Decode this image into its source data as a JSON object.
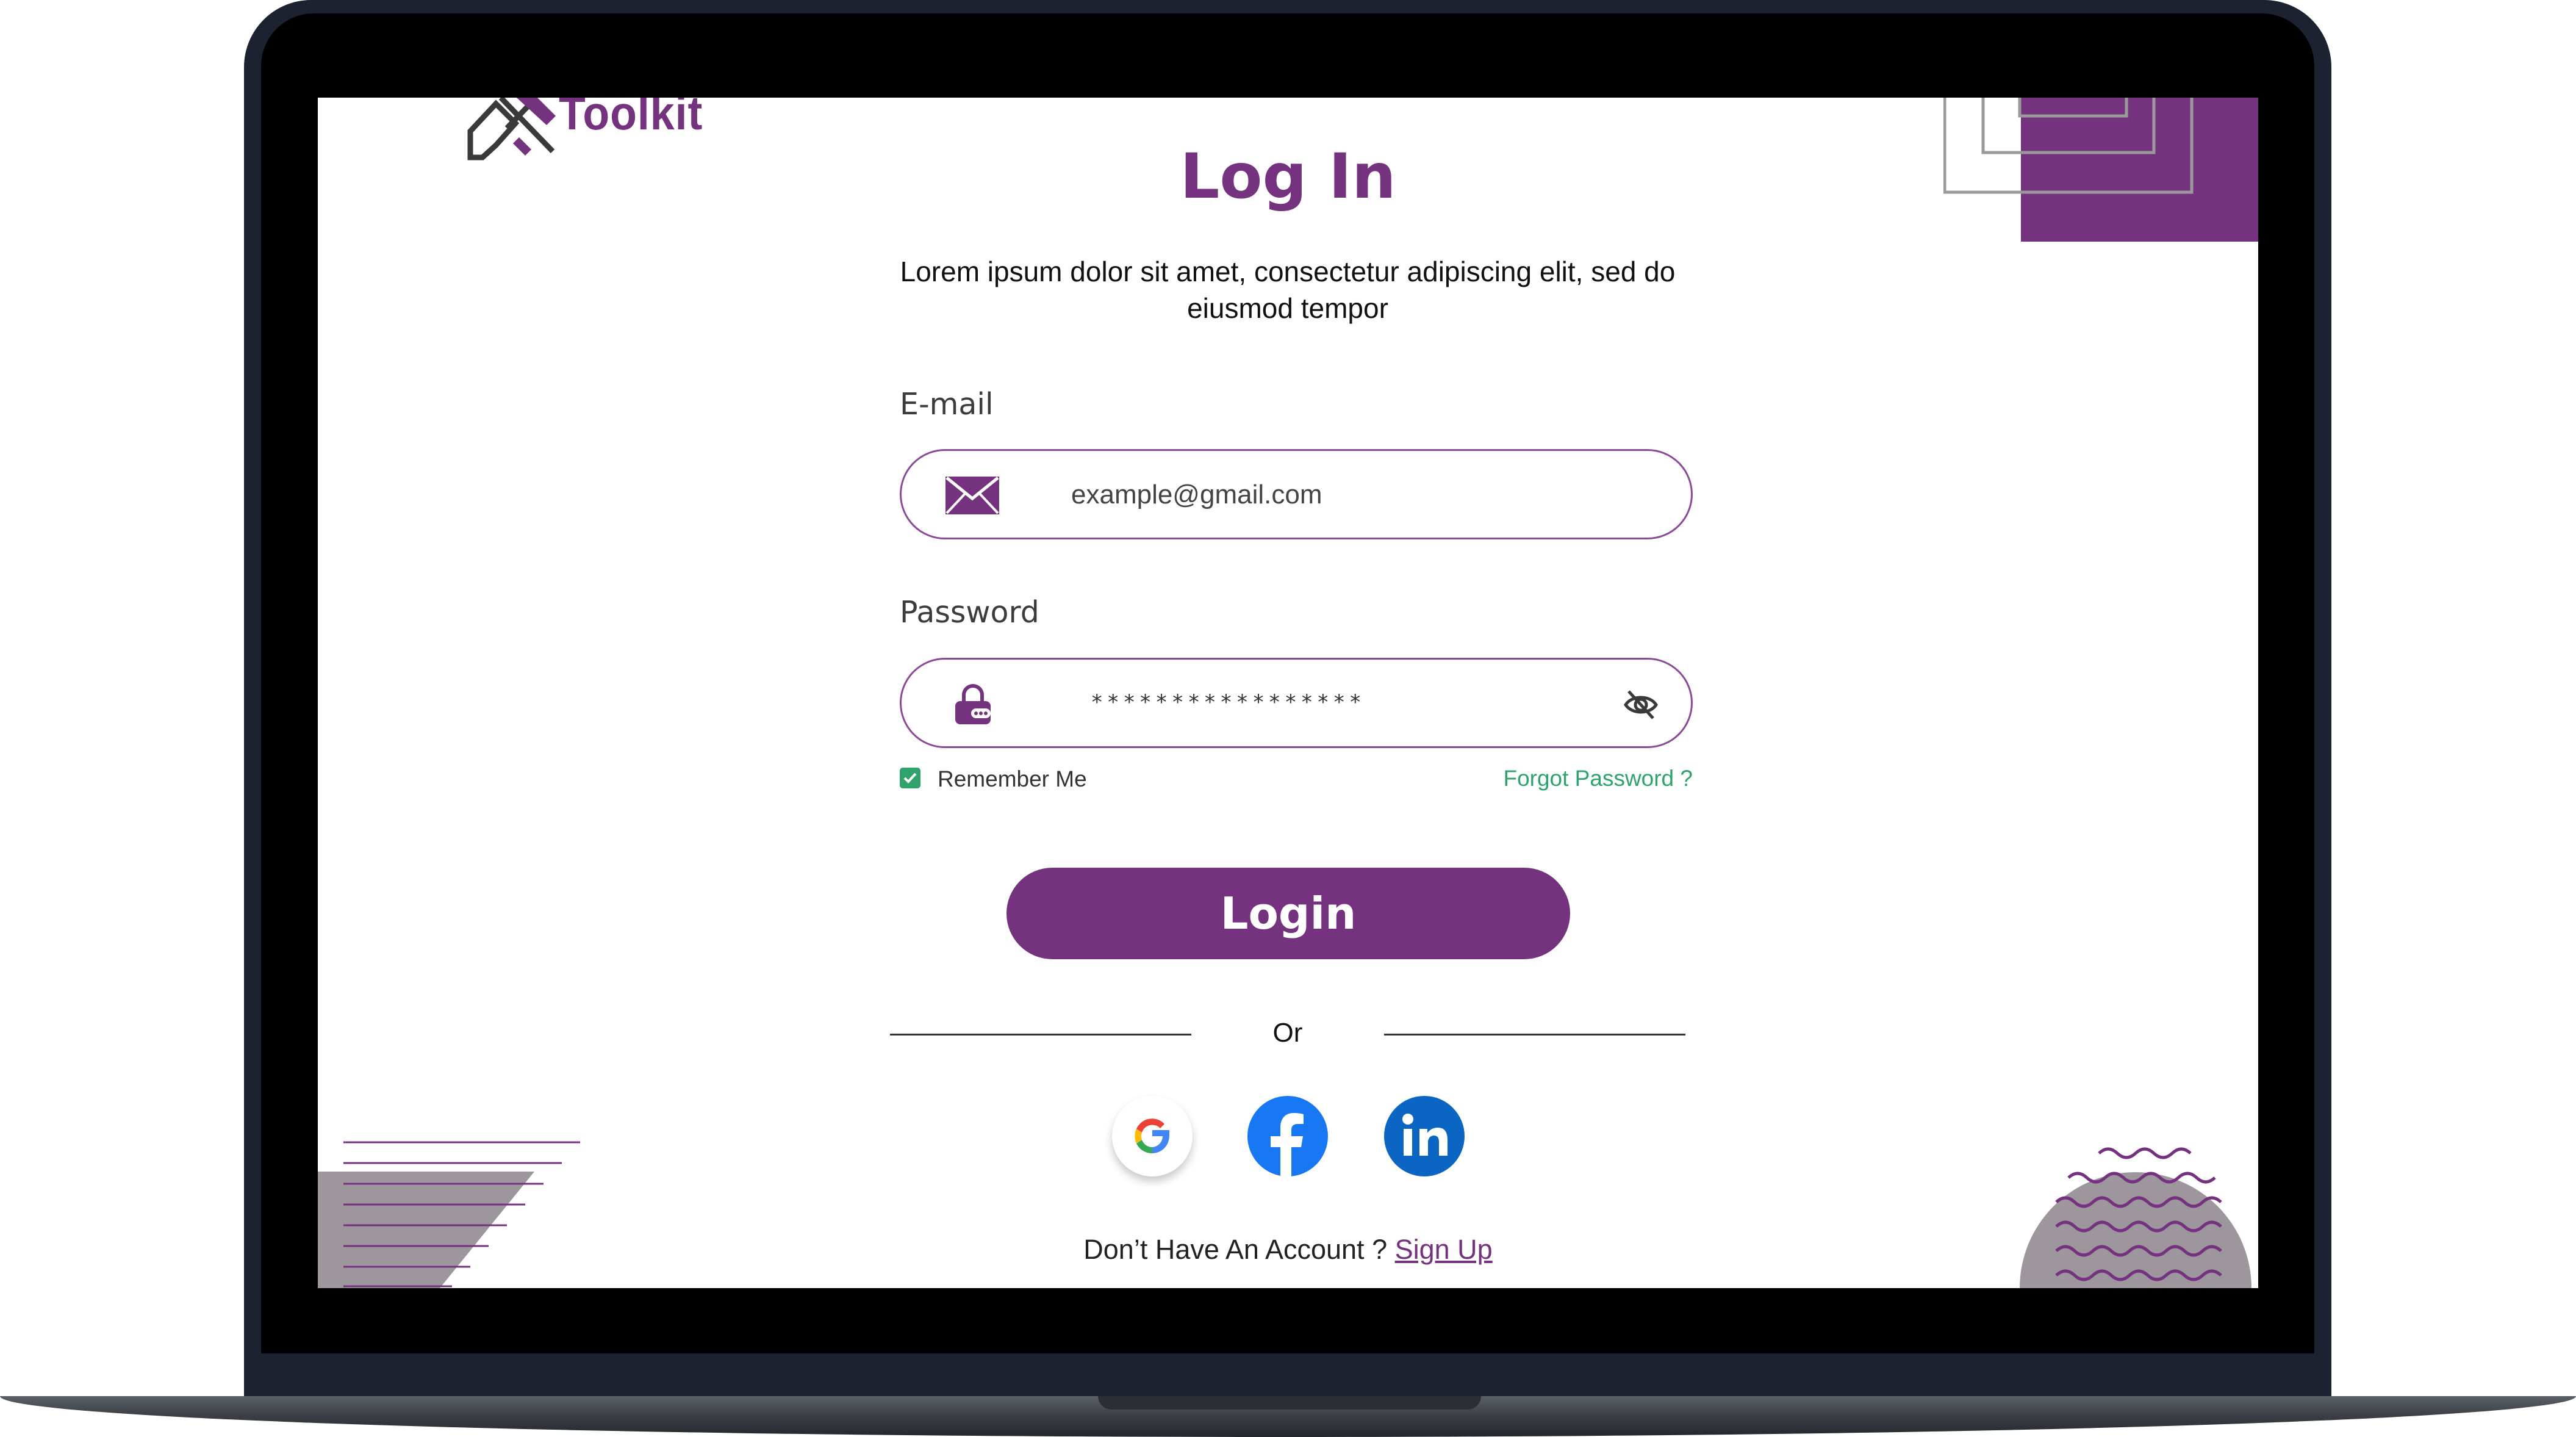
{
  "brand": {
    "name": "Toolkit",
    "accent": "#74327f",
    "success": "#2fa36b"
  },
  "page": {
    "title": "Log In",
    "subtitle": "Lorem ipsum dolor sit amet, consectetur adipiscing elit, sed do eiusmod tempor"
  },
  "email": {
    "label": "E-mail",
    "value": "example@gmail.com",
    "icon": "envelope-icon"
  },
  "password": {
    "label": "Password",
    "value": "*****************",
    "icon": "lock-icon",
    "toggle_icon": "eye-off-icon"
  },
  "remember": {
    "label": "Remember Me",
    "checked": true
  },
  "forgot": {
    "label": "Forgot Password ?"
  },
  "login": {
    "label": "Login"
  },
  "divider": {
    "label": "Or"
  },
  "social": [
    {
      "name": "Google",
      "icon": "google-icon"
    },
    {
      "name": "Facebook",
      "icon": "facebook-icon"
    },
    {
      "name": "LinkedIn",
      "icon": "linkedin-icon"
    }
  ],
  "signup": {
    "prompt": "Don’t Have An Account ?",
    "link": "Sign Up"
  }
}
